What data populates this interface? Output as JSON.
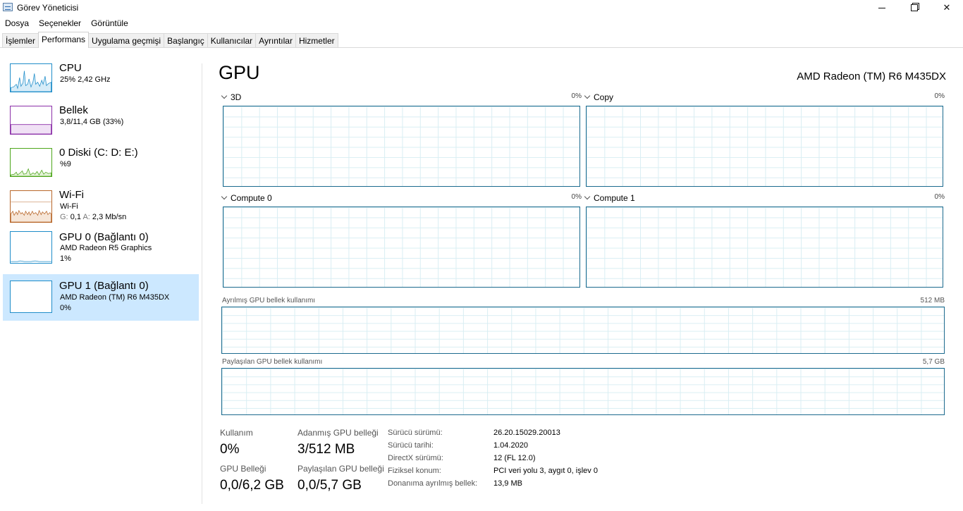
{
  "window": {
    "title": "Görev Yöneticisi"
  },
  "menu": [
    "Dosya",
    "Seçenekler",
    "Görüntüle"
  ],
  "tabs": [
    "İşlemler",
    "Performans",
    "Uygulama geçmişi",
    "Başlangıç",
    "Kullanıcılar",
    "Ayrıntılar",
    "Hizmetler"
  ],
  "active_tab": "Performans",
  "sidebar": {
    "items": [
      {
        "name": "CPU",
        "sub1": "25% 2,42 GHz",
        "sub2": "",
        "color": "#1f8dc9"
      },
      {
        "name": "Bellek",
        "sub1": "3,8/11,4 GB (33%)",
        "sub2": "",
        "color": "#8b2fa8"
      },
      {
        "name": "0 Diski (C: D: E:)",
        "sub1": "%9",
        "sub2": "",
        "color": "#4da61b"
      },
      {
        "name": "Wi-Fi",
        "sub1": "Wi-Fi",
        "sub2_g": "G:",
        "sub2_g_val": "0,1",
        "sub2_a": "A:",
        "sub2_a_val": "2,3 Mb/sn",
        "color": "#b8672a"
      },
      {
        "name": "GPU 0 (Bağlantı 0)",
        "sub1": "AMD Radeon R5 Graphics",
        "sub2": "1%",
        "color": "#1f8dc9"
      },
      {
        "name": "GPU 1 (Bağlantı 0)",
        "sub1": "AMD Radeon (TM) R6 M435DX",
        "sub2": "0%",
        "color": "#1f8dc9",
        "selected": true
      }
    ]
  },
  "main": {
    "title": "GPU",
    "model": "AMD Radeon (TM) R6 M435DX",
    "engines": [
      {
        "name": "3D",
        "pct": "0%"
      },
      {
        "name": "Copy",
        "pct": "0%"
      },
      {
        "name": "Compute 0",
        "pct": "0%"
      },
      {
        "name": "Compute 1",
        "pct": "0%"
      }
    ],
    "dedicated": {
      "label": "Ayrılmış GPU bellek kullanımı",
      "max": "512 MB"
    },
    "shared": {
      "label": "Paylaşılan GPU bellek kullanımı",
      "max": "5,7 GB"
    },
    "stats": {
      "usage_label": "Kullanım",
      "usage_value": "0%",
      "dedicated_label": "Adanmış GPU belleği",
      "dedicated_value": "3/512 MB",
      "gpu_mem_label": "GPU Belleği",
      "gpu_mem_value": "0,0/6,2 GB",
      "shared_label": "Paylaşılan GPU belleği",
      "shared_value": "0,0/5,7 GB"
    },
    "info": [
      {
        "label": "Sürücü sürümü:",
        "value": "26.20.15029.20013"
      },
      {
        "label": "Sürücü tarihi:",
        "value": "1.04.2020"
      },
      {
        "label": "DirectX sürümü:",
        "value": "12 (FL 12.0)"
      },
      {
        "label": "Fiziksel konum:",
        "value": "PCI veri yolu 3, aygıt 0, işlev 0"
      },
      {
        "label": "Donanıma ayrılmış bellek:",
        "value": "13,9 MB"
      }
    ]
  }
}
